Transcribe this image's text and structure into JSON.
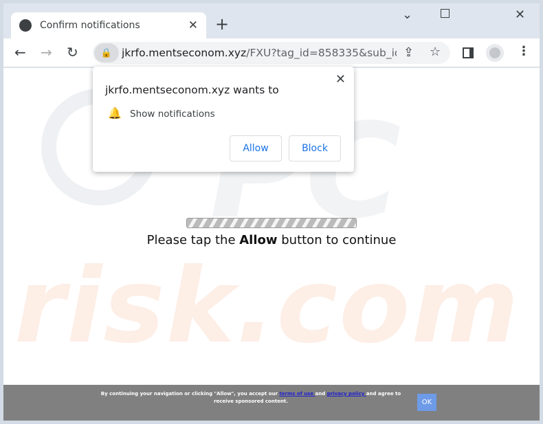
{
  "tab": {
    "title": "Confirm notifications",
    "icon": "globe-icon"
  },
  "toolbar": {
    "domain": "jkrfo.mentseconom.xyz",
    "path": "/FXU?tag_id=858335&sub_id..."
  },
  "popup": {
    "title": "jkrfo.mentseconom.xyz wants to",
    "permission": "Show notifications",
    "allow": "Allow",
    "block": "Block"
  },
  "page": {
    "msg_before": "Please tap the ",
    "msg_bold": "Allow",
    "msg_after": " button to continue",
    "watermark": "risk.com"
  },
  "footer": {
    "text1": "By continuing your navigation or clicking \"Allow\", you accept our ",
    "terms": "terms of use ",
    "text2": "and ",
    "privacy": "privacy policy ",
    "text3": "and agree to receive sponsored content.",
    "ok": "OK"
  }
}
